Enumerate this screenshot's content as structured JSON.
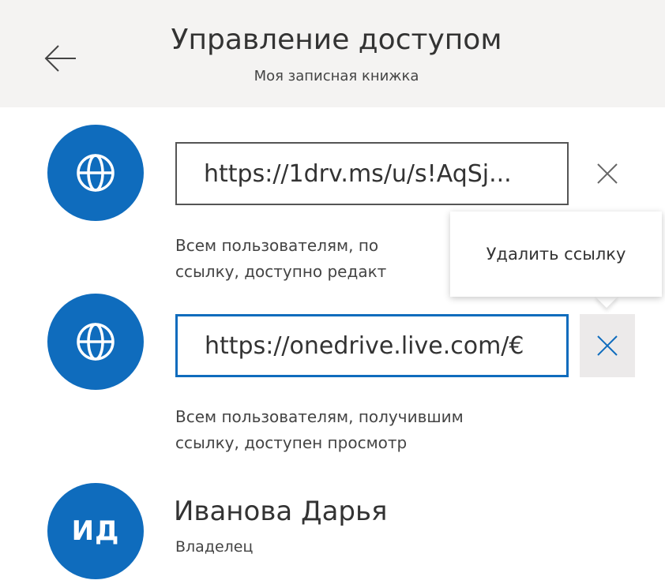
{
  "header": {
    "title": "Управление доступом",
    "subtitle": "Моя записная книжка",
    "back_icon": "arrow-left-icon"
  },
  "links": [
    {
      "icon": "globe-icon",
      "url": "https://1drv.ms/u/s!AqSj...",
      "permission_line1": "Всем пользователям, по",
      "permission_line2": "ссылку, доступно редакт",
      "remove_icon": "close-icon"
    },
    {
      "icon": "globe-icon",
      "url": "https://onedrive.live.com/€",
      "permission_line1": "Всем пользователям, получившим",
      "permission_line2": "ссылку, доступен просмотр",
      "remove_icon": "close-icon"
    }
  ],
  "tooltip": {
    "text": "Удалить ссылку"
  },
  "owner": {
    "initials": "ИД",
    "name": "Иванова Дарья",
    "role": "Владелец"
  },
  "colors": {
    "accent": "#0f6cbd",
    "header_bg": "#f4f3f2"
  }
}
